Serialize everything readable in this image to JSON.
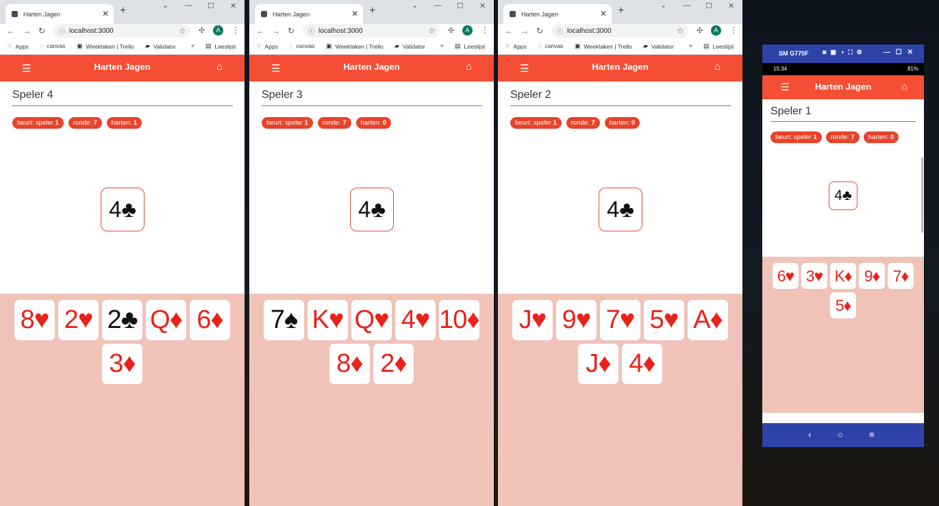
{
  "browser": {
    "tab_title": "Harten Jagen",
    "url": "localhost:3000",
    "bookmarks": [
      "Apps",
      "canvas",
      "Weektaken | Trello",
      "Validator",
      "Leeslijst"
    ],
    "bookmark_overflow": "»",
    "new_tab": "+",
    "tab_close": "✕",
    "avatar_letter": "A",
    "window_controls": [
      "⌄",
      "—",
      "☐",
      "✕"
    ]
  },
  "app": {
    "title": "Harten Jagen",
    "menu_icon": "☰",
    "home_icon": "⌂"
  },
  "chip_labels": {
    "turn": "beurt: speler",
    "round": "ronde:",
    "hearts": "harten:"
  },
  "windows": [
    {
      "player": "Speler 4",
      "turn": "1",
      "round": "7",
      "hearts": "1",
      "pile": {
        "rank": "4",
        "suit": "♣",
        "color": "black"
      },
      "hand": [
        {
          "rank": "8",
          "suit": "♥",
          "color": "red"
        },
        {
          "rank": "2",
          "suit": "♥",
          "color": "red"
        },
        {
          "rank": "2",
          "suit": "♣",
          "color": "black"
        },
        {
          "rank": "Q",
          "suit": "♦",
          "color": "red"
        },
        {
          "rank": "6",
          "suit": "♦",
          "color": "red"
        },
        {
          "rank": "3",
          "suit": "♦",
          "color": "red"
        }
      ]
    },
    {
      "player": "Speler 3",
      "turn": "1",
      "round": "7",
      "hearts": "0",
      "pile": {
        "rank": "4",
        "suit": "♣",
        "color": "black"
      },
      "hand": [
        {
          "rank": "7",
          "suit": "♠",
          "color": "black"
        },
        {
          "rank": "K",
          "suit": "♥",
          "color": "red"
        },
        {
          "rank": "Q",
          "suit": "♥",
          "color": "red"
        },
        {
          "rank": "4",
          "suit": "♥",
          "color": "red"
        },
        {
          "rank": "10",
          "suit": "♦",
          "color": "red"
        },
        {
          "rank": "8",
          "suit": "♦",
          "color": "red"
        },
        {
          "rank": "2",
          "suit": "♦",
          "color": "red"
        }
      ]
    },
    {
      "player": "Speler 2",
      "turn": "1",
      "round": "7",
      "hearts": "0",
      "pile": {
        "rank": "4",
        "suit": "♣",
        "color": "black"
      },
      "hand": [
        {
          "rank": "J",
          "suit": "♥",
          "color": "red"
        },
        {
          "rank": "9",
          "suit": "♥",
          "color": "red"
        },
        {
          "rank": "7",
          "suit": "♥",
          "color": "red"
        },
        {
          "rank": "5",
          "suit": "♥",
          "color": "red"
        },
        {
          "rank": "A",
          "suit": "♦",
          "color": "red"
        },
        {
          "rank": "J",
          "suit": "♦",
          "color": "red"
        },
        {
          "rank": "4",
          "suit": "♦",
          "color": "red"
        }
      ]
    }
  ],
  "phone": {
    "device_name": "SM G770F",
    "time": "15:34",
    "battery": "81%",
    "player": "Speler 1",
    "turn": "1",
    "round": "7",
    "hearts": "0",
    "pile": {
      "rank": "4",
      "suit": "♣",
      "color": "black"
    },
    "hand": [
      {
        "rank": "6",
        "suit": "♥",
        "color": "red"
      },
      {
        "rank": "3",
        "suit": "♥",
        "color": "red"
      },
      {
        "rank": "K",
        "suit": "♦",
        "color": "red"
      },
      {
        "rank": "9",
        "suit": "♦",
        "color": "red"
      },
      {
        "rank": "7",
        "suit": "♦",
        "color": "red"
      },
      {
        "rank": "5",
        "suit": "♦",
        "color": "red"
      }
    ],
    "nav": [
      "‹",
      "○",
      "≡"
    ]
  },
  "colors": {
    "accent": "#f44e34",
    "hand_bg": "#f0c2b8",
    "phone_bar": "#2d43a8",
    "red_suit": "#e8231b"
  }
}
